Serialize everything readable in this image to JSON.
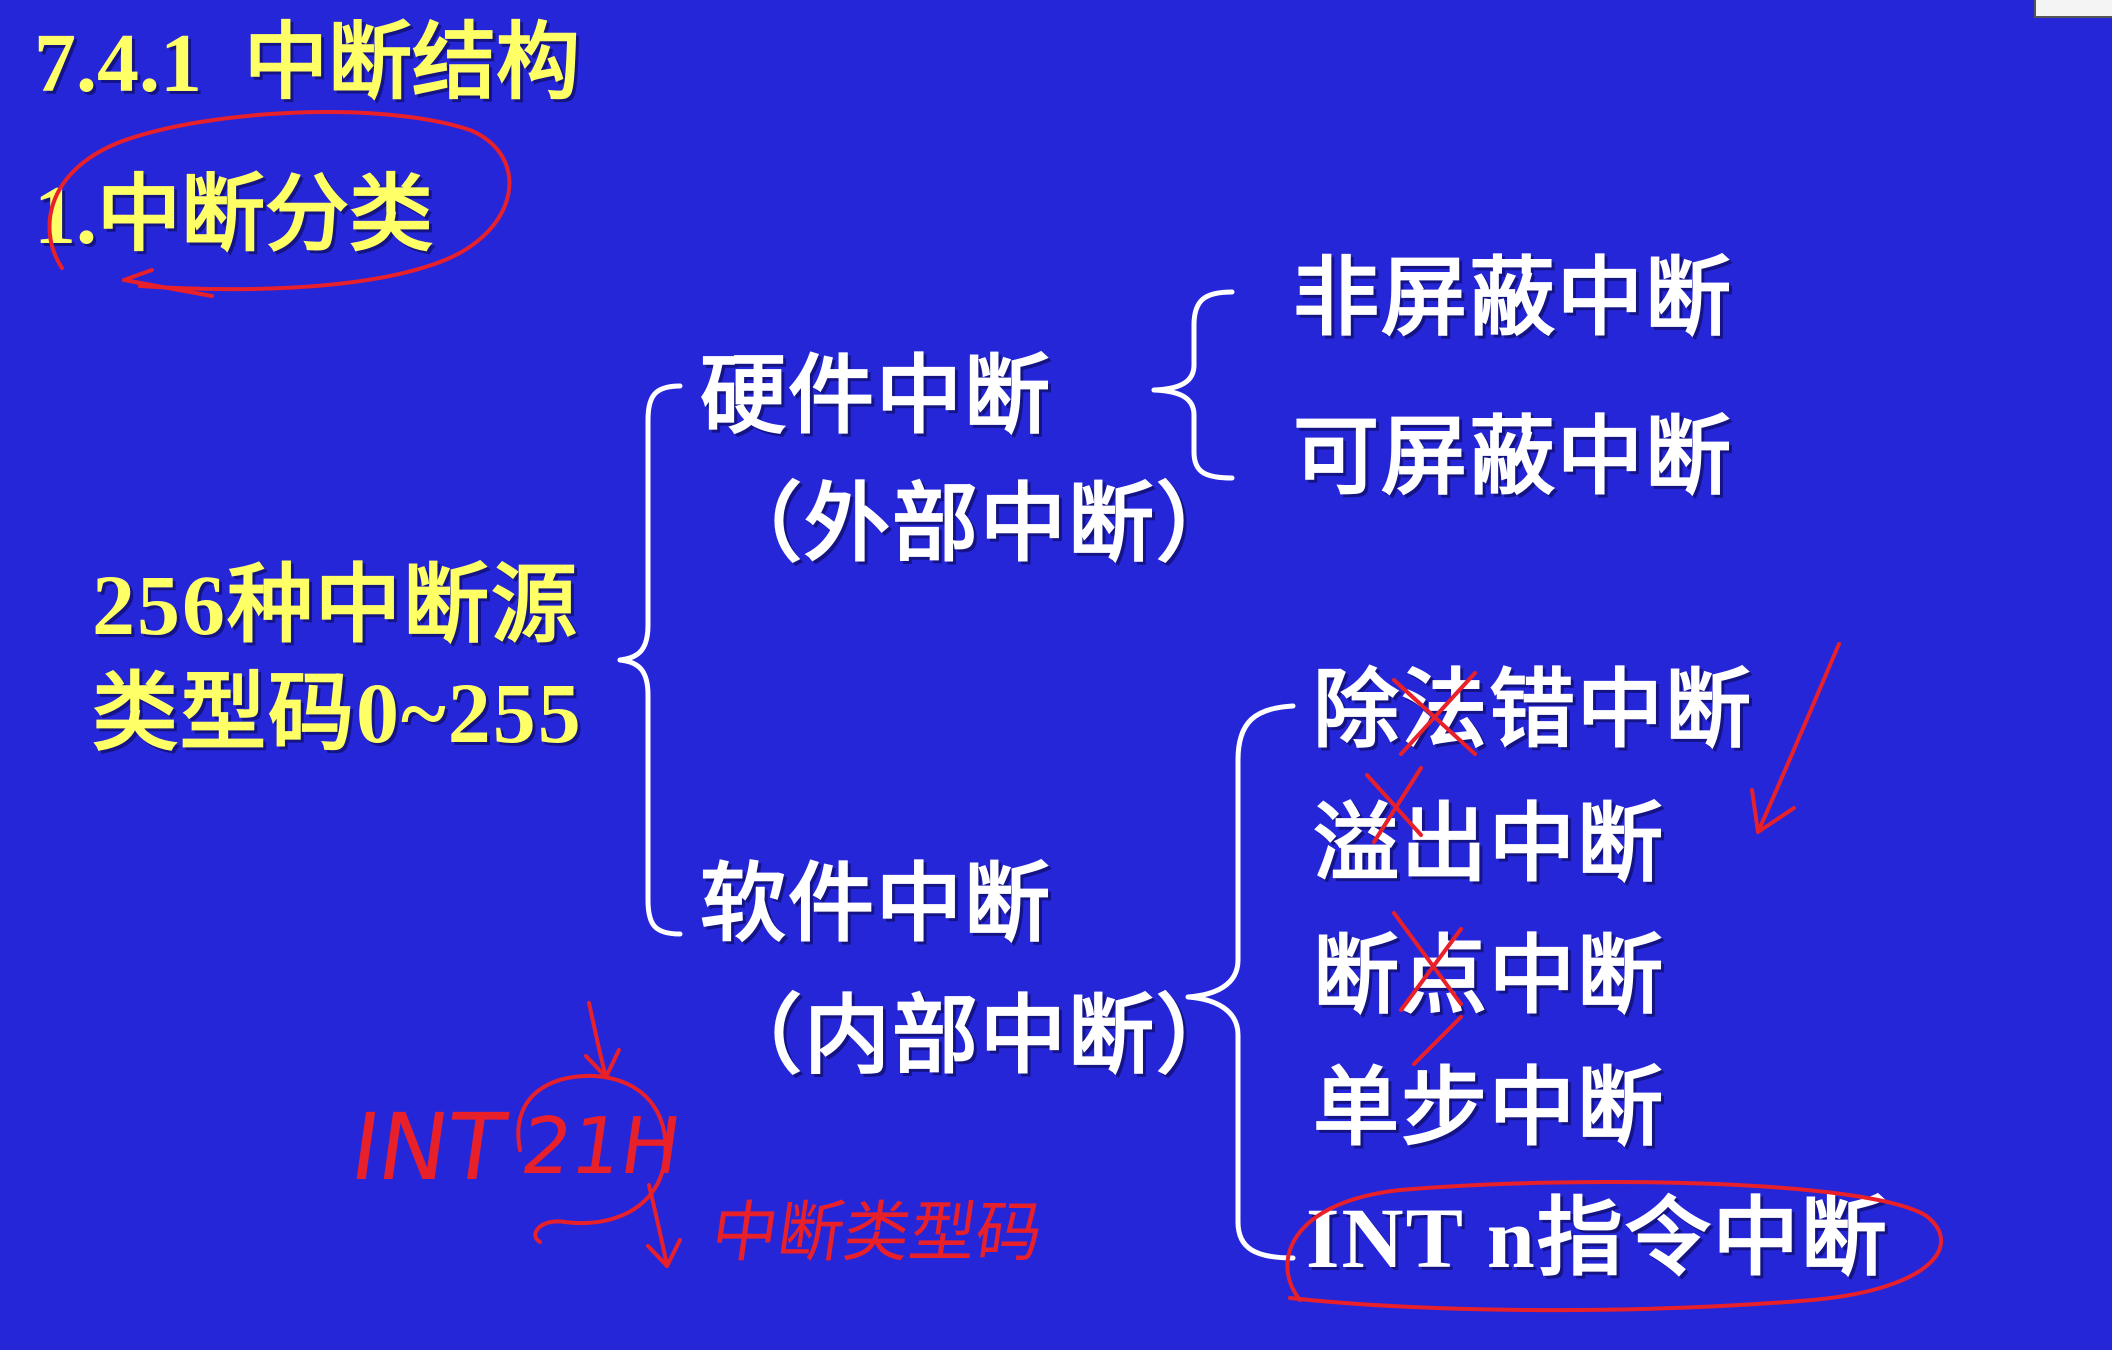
{
  "slide": {
    "section_title": "7.4.1  中断结构",
    "subsection_title": "1.中断分类",
    "root": {
      "line1": "256种中断源",
      "line2": "类型码0~255"
    },
    "hardware": {
      "label": "硬件中断",
      "sublabel": "（外部中断）",
      "items": [
        "非屏蔽中断",
        "可屏蔽中断"
      ]
    },
    "software": {
      "label": "软件中断",
      "sublabel": "（内部中断）",
      "items": [
        "除法错中断",
        "溢出中断",
        "断点中断",
        "单步中断",
        "INT n指令中断"
      ]
    }
  },
  "annotations": {
    "int_text": "INT",
    "code_text": "21H",
    "note_text": "中断类型码"
  },
  "colors": {
    "background": "#2626d9",
    "title": "#ffff66",
    "text": "#ffffff",
    "annotation": "#e8202a"
  }
}
